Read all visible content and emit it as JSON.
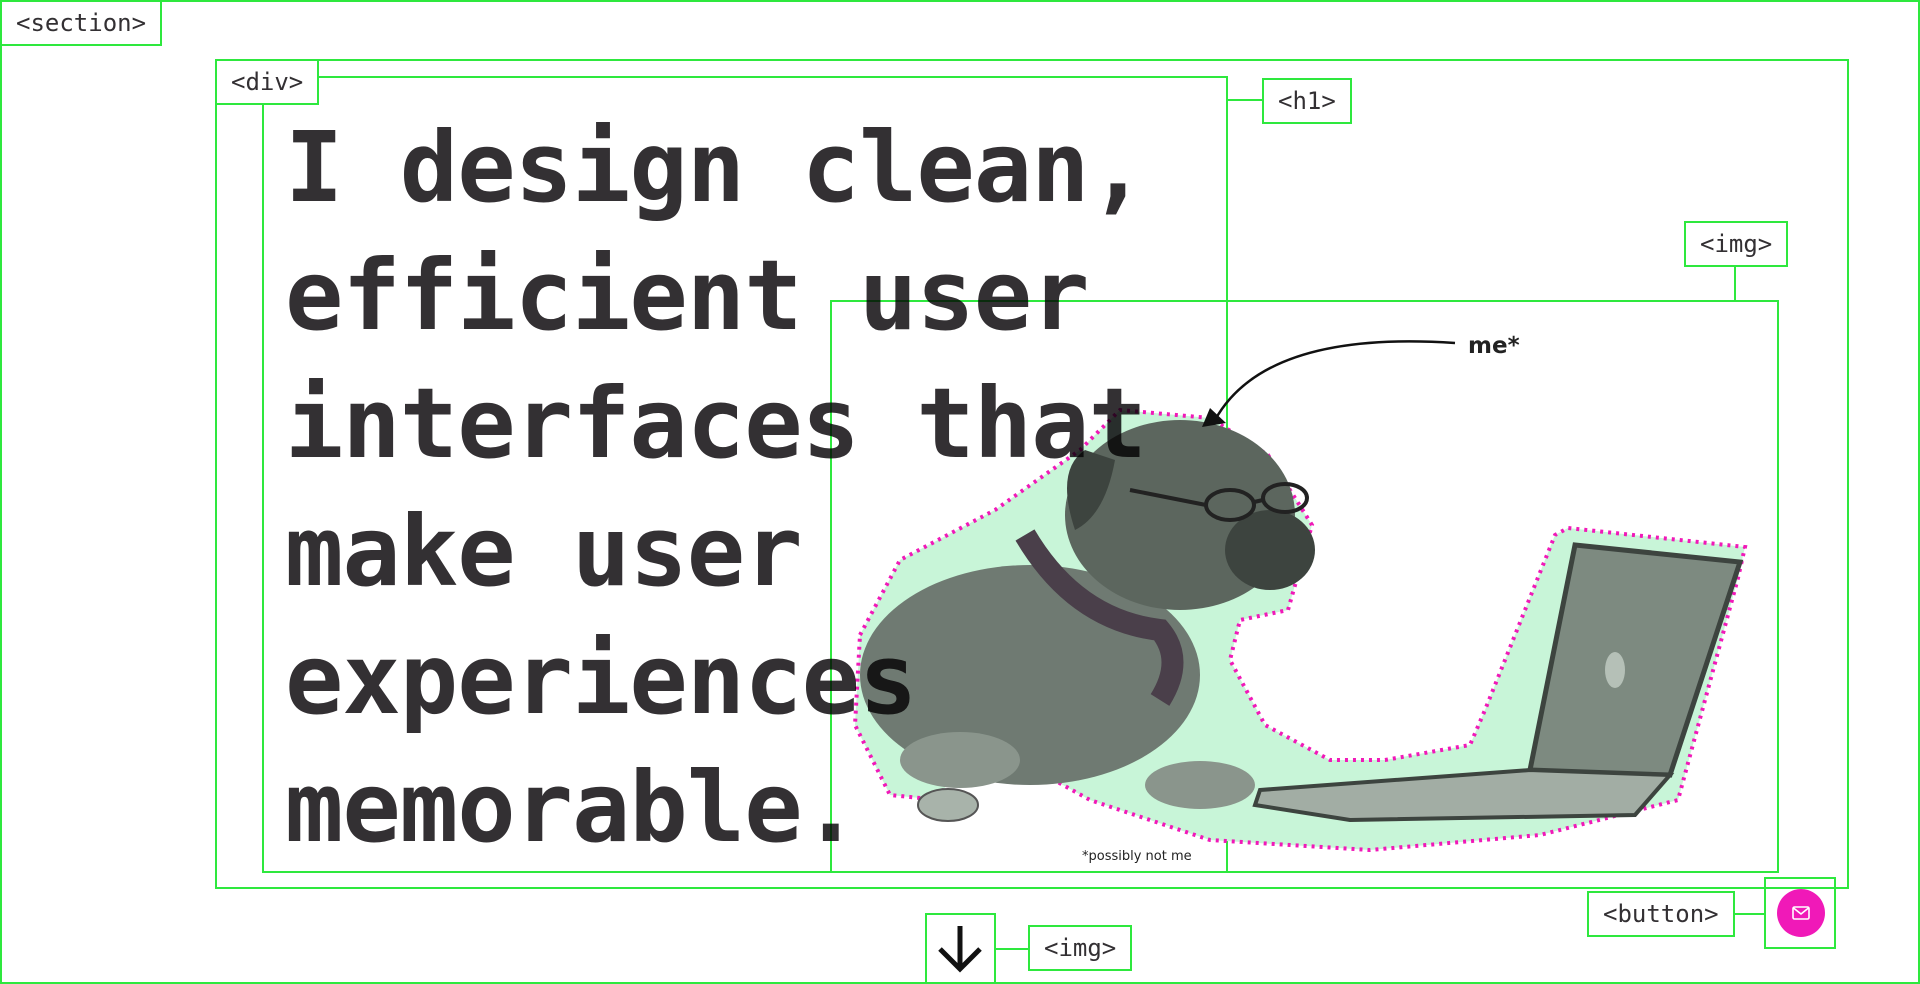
{
  "overlay_tags": {
    "section": "<section>",
    "div": "<div>",
    "h1": "<h1>",
    "img_hero": "<img>",
    "button": "<button>",
    "img_arrow": "<img>"
  },
  "hero": {
    "headline_lines": [
      "I design clean,",
      "efficient user",
      "interfaces that",
      "make user",
      "experiences",
      "memorable."
    ],
    "annotation_me": "me*",
    "annotation_footnote": "*possibly not me"
  },
  "icons": {
    "contact": "mail-icon",
    "scroll": "arrow-down-icon"
  },
  "colors": {
    "text": "#333033",
    "accent_pink": "#f019b8",
    "sticker_mint": "#c8f5d8",
    "outline_green": "#2ee83e"
  }
}
